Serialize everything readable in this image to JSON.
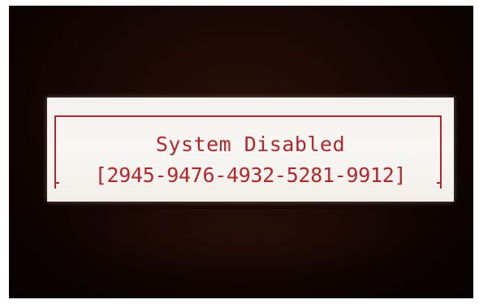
{
  "dialog": {
    "title": "System Disabled",
    "code": "[2945-9476-4932-5281-9912]"
  },
  "colors": {
    "text": "#b3262a",
    "dialog_background": "#f6f3f0",
    "screen_background": "#1a0805"
  }
}
